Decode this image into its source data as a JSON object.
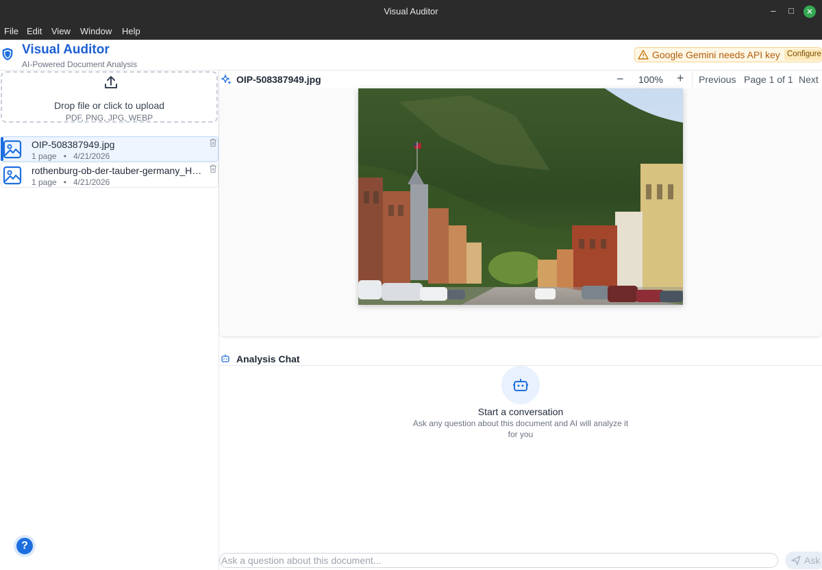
{
  "window": {
    "title": "Visual Auditor",
    "controls": {
      "minimize": "–",
      "maximize": "□",
      "close": "✕"
    }
  },
  "menubar": [
    "File",
    "Edit",
    "View",
    "Window",
    "Help"
  ],
  "header": {
    "app_name": "Visual Auditor",
    "subtitle": "AI-Powered Document Analysis",
    "api_warning": "Google Gemini needs API key",
    "configure_label": "Configure"
  },
  "sidebar": {
    "upload": {
      "label": "Drop file or click to upload",
      "types": "PDF, PNG, JPG, WEBP"
    },
    "files": [
      {
        "name": "OIP-508387949.jpg",
        "pages": "1 page",
        "separator": "•",
        "date": "4/21/2026",
        "active": true
      },
      {
        "name": "rothenburg-ob-der-tauber-germany_HDR.jpg",
        "pages": "1 page",
        "separator": "•",
        "date": "4/21/2026",
        "active": false
      }
    ],
    "help_label": "?"
  },
  "viewer": {
    "title": "OIP-508387949.jpg",
    "zoom_out": "−",
    "zoom": "100%",
    "zoom_in": "+",
    "prev": "Previous",
    "page_indicator": "Page 1 of 1",
    "next": "Next"
  },
  "chat": {
    "title": "Analysis Chat",
    "empty_title": "Start a conversation",
    "empty_subtitle": "Ask any question about this document and AI will analyze it for you",
    "placeholder": "Ask a question about this document...",
    "ask_label": "Ask"
  },
  "colors": {
    "brand": "#1d5fd3",
    "accent": "#1d6fe0",
    "warning_bg": "#fff7e6",
    "warning_text": "#b25d09",
    "titlebar": "#2b2b2b"
  },
  "icons": {
    "logo": "shield-icon",
    "warning": "warning-triangle-icon",
    "upload": "upload-icon",
    "file": "image-file-icon",
    "delete": "trash-icon",
    "viewer": "sparkle-icon",
    "chat": "bot-icon",
    "send": "send-icon",
    "help": "help-icon"
  }
}
